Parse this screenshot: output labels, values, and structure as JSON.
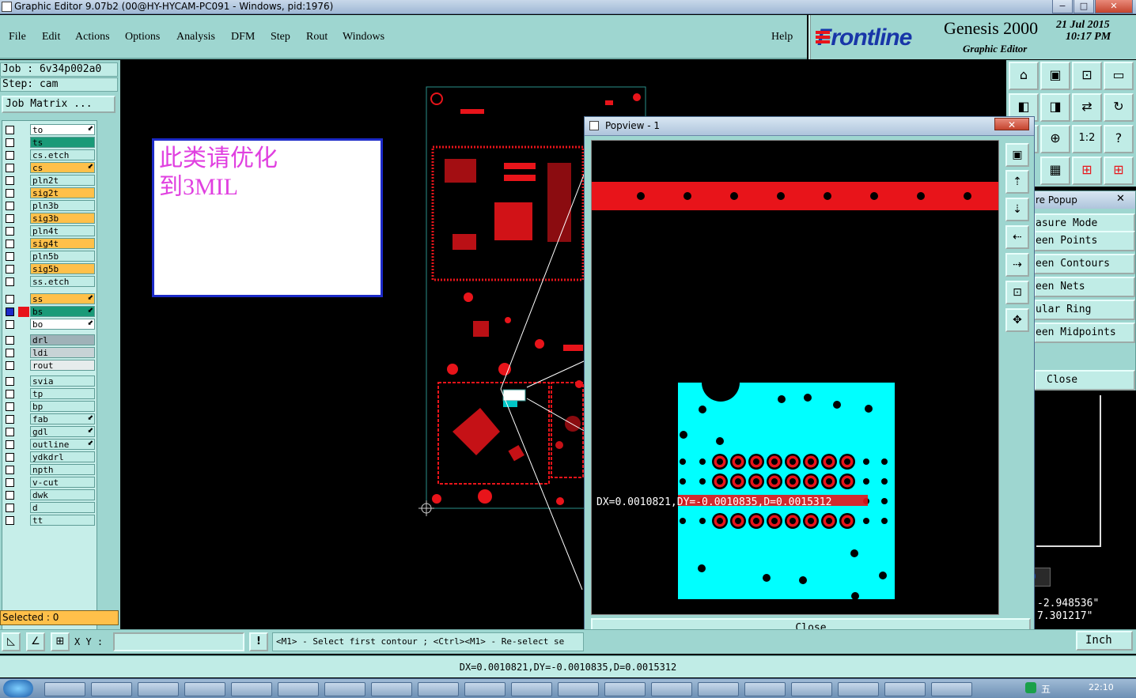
{
  "window": {
    "title": "Graphic Editor 9.07b2 (00@HY-HYCAM-PC091 - Windows, pid:1976)",
    "controls": [
      "−",
      "□",
      "✕"
    ]
  },
  "menu": [
    "File",
    "Edit",
    "Actions",
    "Options",
    "Analysis",
    "DFM",
    "Step",
    "Rout",
    "Windows"
  ],
  "help_label": "Help",
  "brand": {
    "logo": "Frontline",
    "product": "Genesis 2000",
    "subtitle": "Graphic Editor",
    "date": "21 Jul 2015",
    "time": "10:17 PM"
  },
  "job": {
    "job_label": "Job : 6v34p002a0",
    "step_label": "Step: cam",
    "matrix_button": "Job Matrix ..."
  },
  "layers": [
    {
      "name": "to",
      "color": "#ffffff",
      "arrow": true
    },
    {
      "name": "ts",
      "color": "#1a9a78",
      "arrow": false
    },
    {
      "name": "cs.etch",
      "color": "#c0ece6",
      "arrow": false
    },
    {
      "name": "cs",
      "color": "#ffc04a",
      "arrow": true
    },
    {
      "name": "pln2t",
      "color": "#c0ece6",
      "arrow": false
    },
    {
      "name": "sig2t",
      "color": "#ffc04a",
      "arrow": false
    },
    {
      "name": "pln3b",
      "color": "#c0ece6",
      "arrow": false
    },
    {
      "name": "sig3b",
      "color": "#ffc04a",
      "arrow": false
    },
    {
      "name": "pln4t",
      "color": "#c0ece6",
      "arrow": false
    },
    {
      "name": "sig4t",
      "color": "#ffc04a",
      "arrow": false
    },
    {
      "name": "pln5b",
      "color": "#c0ece6",
      "arrow": false
    },
    {
      "name": "sig5b",
      "color": "#ffc04a",
      "arrow": false
    },
    {
      "name": "ss.etch",
      "color": "#c0ece6",
      "arrow": false
    },
    {
      "name": "ss",
      "color": "#ffc04a",
      "arrow": true
    },
    {
      "name": "bs",
      "color": "#1a9a78",
      "arrow": true,
      "active": true
    },
    {
      "name": "bo",
      "color": "#ffffff",
      "arrow": true
    },
    {
      "name": "drl",
      "color": "#9fb2b8",
      "arrow": false
    },
    {
      "name": "ldi",
      "color": "#c7d3d6",
      "arrow": false
    },
    {
      "name": "rout",
      "color": "#e6ecec",
      "arrow": false
    },
    {
      "name": "svia",
      "color": "#c0ece6",
      "arrow": false
    },
    {
      "name": "tp",
      "color": "#c0ece6",
      "arrow": false
    },
    {
      "name": "bp",
      "color": "#c0ece6",
      "arrow": false
    },
    {
      "name": "fab",
      "color": "#c0ece6",
      "arrow": true
    },
    {
      "name": "gdl",
      "color": "#c0ece6",
      "arrow": true
    },
    {
      "name": "outline",
      "color": "#c0ece6",
      "arrow": true
    },
    {
      "name": "ydkdrl",
      "color": "#c0ece6",
      "arrow": false
    },
    {
      "name": "npth",
      "color": "#c0ece6",
      "arrow": false
    },
    {
      "name": "v-cut",
      "color": "#c0ece6",
      "arrow": false
    },
    {
      "name": "dwk",
      "color": "#c0ece6",
      "arrow": false
    },
    {
      "name": "d",
      "color": "#c0ece6",
      "arrow": false
    },
    {
      "name": "tt",
      "color": "#c0ece6",
      "arrow": false
    }
  ],
  "selected_label": "Selected : 0",
  "note": {
    "line1": "此类请优化",
    "line2": "到3MIL"
  },
  "popview": {
    "title": "Popview - 1",
    "measurement": "DX=0.0010821,DY=-0.0010835,D=0.0015312",
    "close_label": "Close"
  },
  "measure_popup": {
    "title": "re Popup",
    "items": [
      "asure Mode",
      "een Points",
      "een Contours",
      "een Nets",
      "ular Ring",
      "een Midpoints"
    ],
    "close_label": "Close"
  },
  "coords": {
    "x": "-2.948536\"",
    "y": "7.301217\""
  },
  "bottom": {
    "xy_label": "X Y :",
    "xy_value": "",
    "prompt": "<M1> - Select first contour ; <Ctrl><M1> - Re-select se",
    "unit": "Inch",
    "status": "DX=0.0010821,DY=-0.0010835,D=0.0015312"
  },
  "taskbar": {
    "clock": "22:10",
    "ime": "五"
  },
  "colors": {
    "panel": "#9ed6d0",
    "field": "#c0ece6",
    "copper": "#e8141a",
    "popview_fill": "#00ffff",
    "note_text": "#e040e0"
  }
}
